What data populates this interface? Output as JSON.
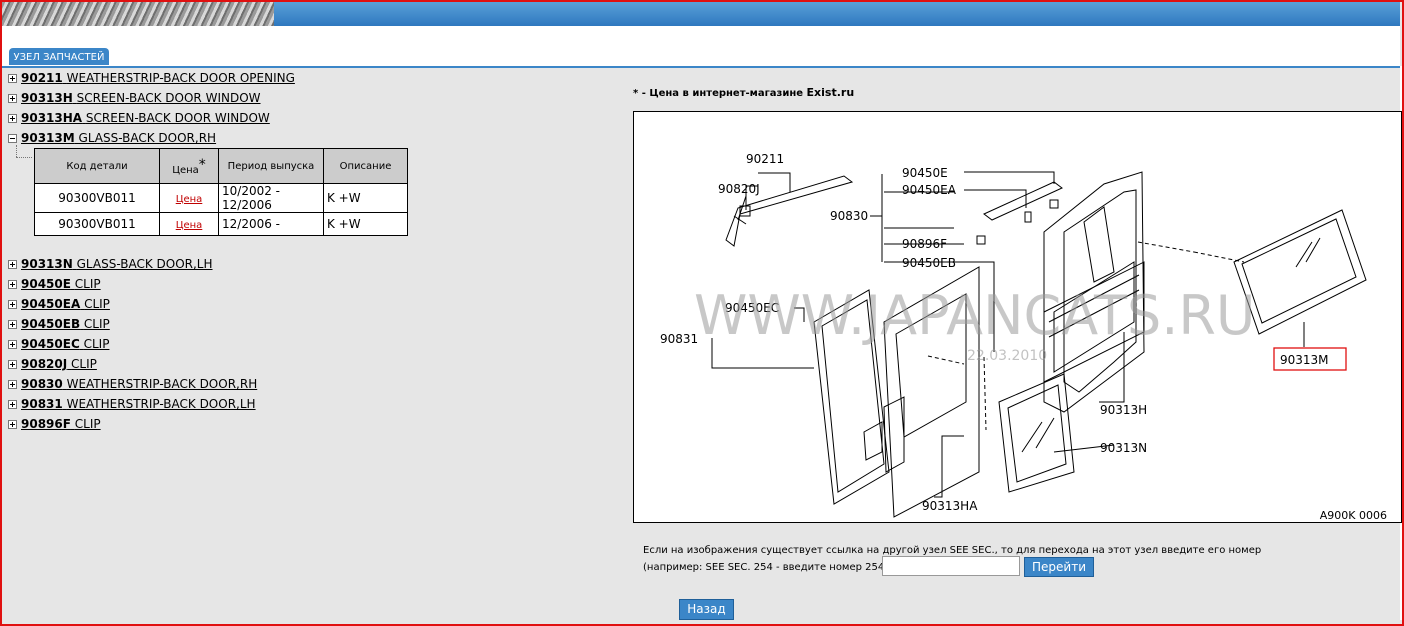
{
  "tab": {
    "label": "УЗЕЛ ЗАПЧАСТЕЙ"
  },
  "tree": {
    "before": [
      {
        "code": "90211",
        "name": "WEATHERSTRIP-BACK DOOR OPENING"
      },
      {
        "code": "90313H",
        "name": "SCREEN-BACK DOOR WINDOW"
      },
      {
        "code": "90313HA",
        "name": "SCREEN-BACK DOOR WINDOW"
      }
    ],
    "expanded": {
      "code": "90313M",
      "name": "GLASS-BACK DOOR,RH"
    },
    "after": [
      {
        "code": "90313N",
        "name": "GLASS-BACK DOOR,LH"
      },
      {
        "code": "90450E",
        "name": "CLIP"
      },
      {
        "code": "90450EA",
        "name": "CLIP"
      },
      {
        "code": "90450EB",
        "name": "CLIP"
      },
      {
        "code": "90450EC",
        "name": "CLIP"
      },
      {
        "code": "90820J",
        "name": "CLIP"
      },
      {
        "code": "90830",
        "name": "WEATHERSTRIP-BACK DOOR,RH"
      },
      {
        "code": "90831",
        "name": "WEATHERSTRIP-BACK DOOR,LH"
      },
      {
        "code": "90896F",
        "name": "CLIP"
      }
    ]
  },
  "table": {
    "headers": {
      "code": "Код детали",
      "price": "Цена",
      "star": "*",
      "period": "Период выпуска",
      "desc": "Описание"
    },
    "rows": [
      {
        "code": "90300VB011",
        "price": "Цена",
        "period": "10/2002 - 12/2006",
        "desc": "K +W"
      },
      {
        "code": "90300VB011",
        "price": "Цена",
        "period": "12/2006 -",
        "desc": "K +W"
      }
    ]
  },
  "exist_note": {
    "prefix": "* - Цена в интернет-магазине ",
    "brand": "Exist.ru"
  },
  "diagram": {
    "watermark": "WWW.JAPANCATS.RU",
    "date": "22.03.2010",
    "code": "A900K 0006",
    "labels": {
      "l90211": "90211",
      "l90820J": "90820J",
      "l90830": "90830",
      "l90450E": "90450E",
      "l90450EA": "90450EA",
      "l90896F": "90896F",
      "l90450EB": "90450EB",
      "l90450EC": "90450EC",
      "l90831": "90831",
      "l90313M": "90313M",
      "l90313H": "90313H",
      "l90313N": "90313N",
      "l90313HA": "90313HA"
    }
  },
  "see_sec": {
    "line1": "Если на изображения существует ссылка на другой узел SEE SEC., то для перехода на этот узел введите его номер",
    "line2": "(например: SEE SEC. 254 - введите номер 254):",
    "input_value": ""
  },
  "buttons": {
    "go": "Перейти",
    "back": "Назад"
  },
  "colors": {
    "accent": "#3b86c8",
    "border_red": "#e01010",
    "price_link": "#c00000"
  }
}
